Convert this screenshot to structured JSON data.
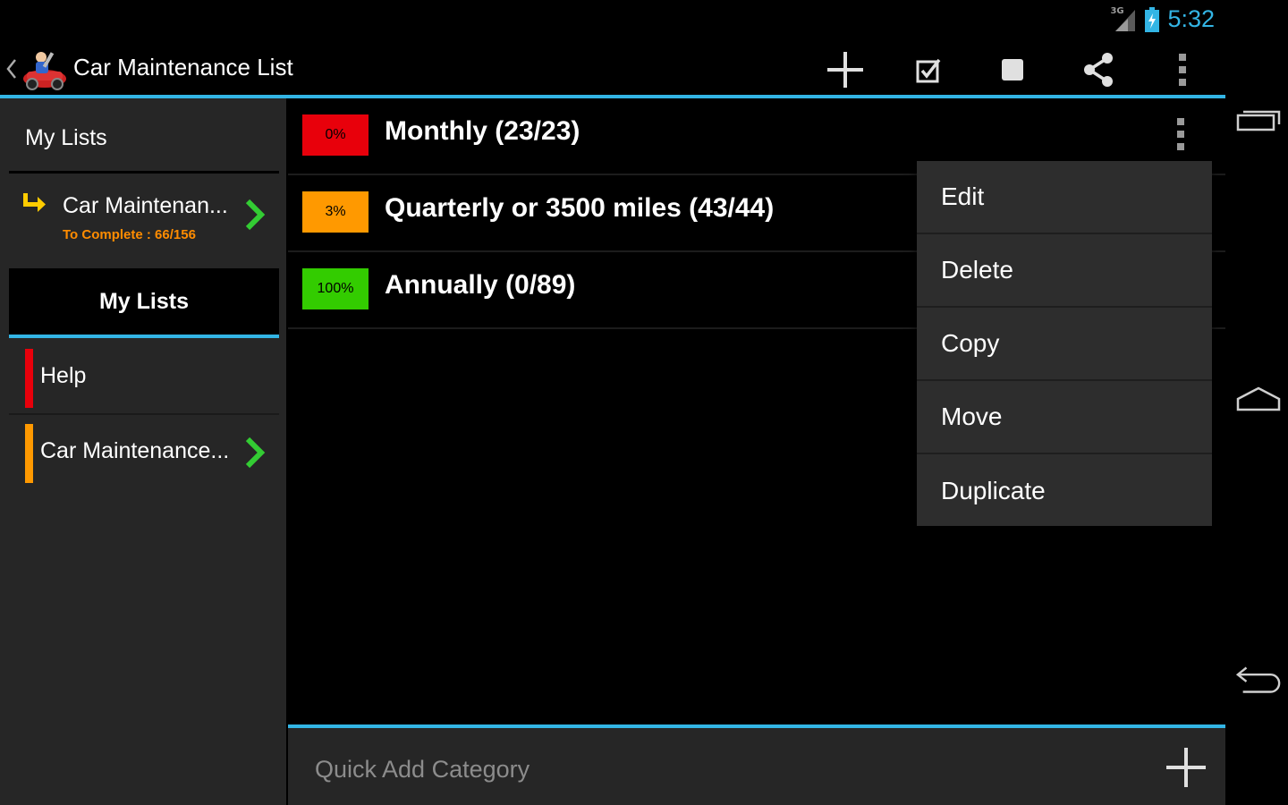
{
  "status_bar": {
    "network_label": "3G",
    "time": "5:32"
  },
  "action_bar": {
    "title": "Car Maintenance List",
    "actions": [
      "add-icon",
      "checkbox-icon",
      "stop-icon",
      "share-icon",
      "overflow-icon"
    ]
  },
  "sidebar": {
    "header": "My Lists",
    "current_list": {
      "title": "Car Maintenan...",
      "subtitle": "To Complete : 66/156"
    },
    "tab_label": "My Lists",
    "items": [
      {
        "label": "Help",
        "color": "#e8000b"
      },
      {
        "label": "Car Maintenance...",
        "color": "#ff9900"
      }
    ]
  },
  "categories": [
    {
      "badge": "0%",
      "badge_color": "#e8000b",
      "badge_text_color": "#000000",
      "label": "Monthly (23/23)",
      "progress": 0
    },
    {
      "badge": "3%",
      "badge_color": "#ff9900",
      "badge_text_color": "#000000",
      "label": "Quarterly or 3500 miles (43/44)",
      "progress": 3
    },
    {
      "badge": "100%",
      "badge_color": "#33cc00",
      "badge_text_color": "#000000",
      "label": "Annually (0/89)",
      "progress": 100
    }
  ],
  "popup_menu": {
    "items": [
      "Edit",
      "Delete",
      "Copy",
      "Move",
      "Duplicate"
    ]
  },
  "quick_add": {
    "placeholder": "Quick Add Category"
  },
  "colors": {
    "accent": "#33b5e5",
    "chevron_green": "#33cc33"
  },
  "nav_bar": {
    "buttons": [
      "recent-apps-icon",
      "home-icon",
      "back-icon"
    ]
  }
}
